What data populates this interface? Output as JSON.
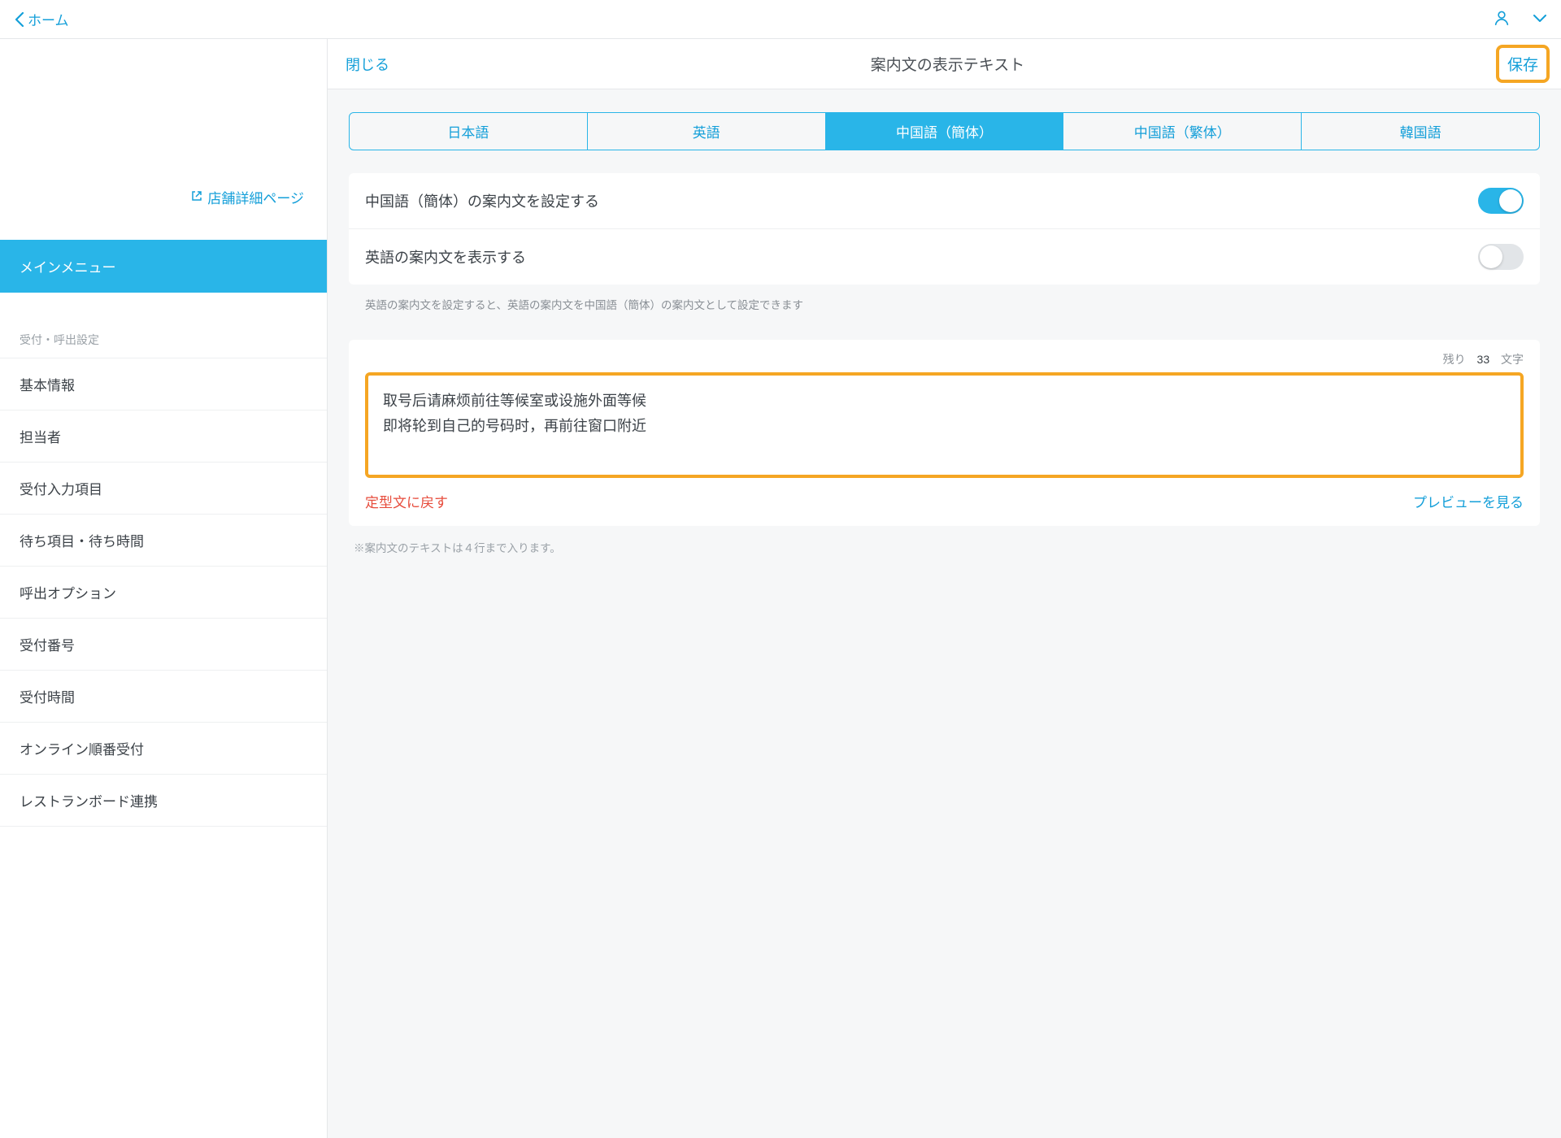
{
  "header": {
    "back_label": "ホーム"
  },
  "sidebar": {
    "store_detail_link": "店舗詳細ページ",
    "active_item": "メインメニュー",
    "section_title": "受付・呼出設定",
    "items": [
      "基本情報",
      "担当者",
      "受付入力項目",
      "待ち項目・待ち時間",
      "呼出オプション",
      "受付番号",
      "受付時間",
      "オンライン順番受付",
      "レストランボード連携"
    ]
  },
  "panel": {
    "close_label": "閉じる",
    "title": "案内文の表示テキスト",
    "save_label": "保存"
  },
  "tabs": {
    "items": [
      "日本語",
      "英語",
      "中国語（簡体）",
      "中国語（繁体）",
      "韓国語"
    ],
    "active_index": 2
  },
  "toggles": {
    "row1_label": "中国語（簡体）の案内文を設定する",
    "row2_label": "英語の案内文を表示する",
    "helper": "英語の案内文を設定すると、英語の案内文を中国語（簡体）の案内文として設定できます"
  },
  "editor": {
    "remaining_prefix": "残り",
    "remaining_count": "33",
    "remaining_suffix": "文字",
    "content": "取号后请麻烦前往等候室或设施外面等候\n即将轮到自己的号码时，再前往窗口附近",
    "reset_label": "定型文に戻す",
    "preview_label": "プレビューを見る",
    "footnote": "※案内文のテキストは４行まで入ります。"
  }
}
